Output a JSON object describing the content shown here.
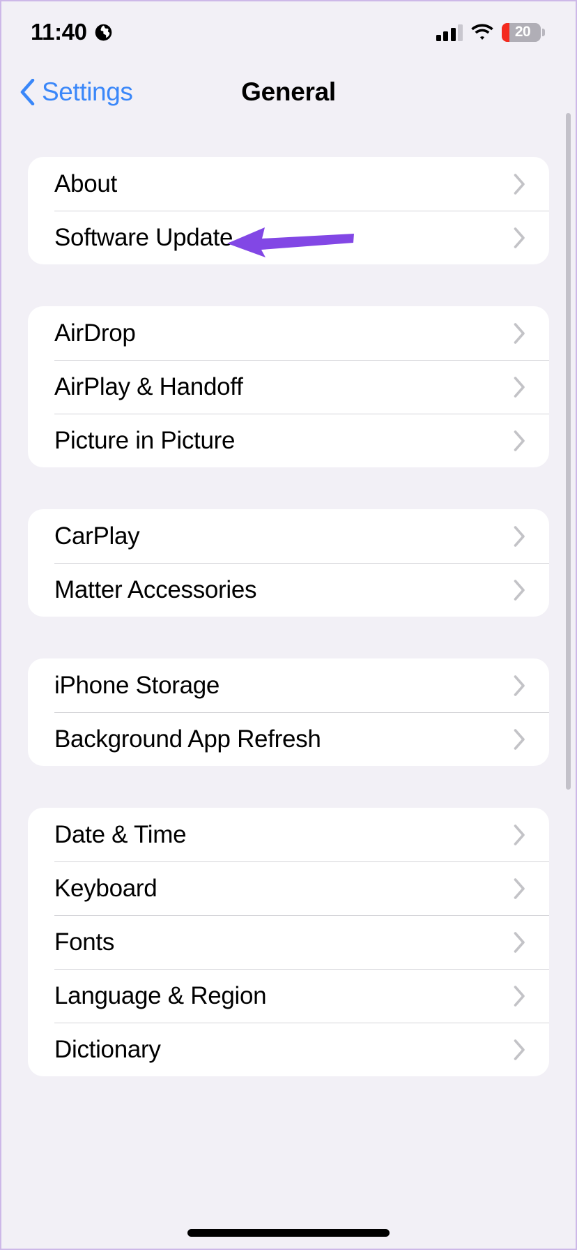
{
  "status_bar": {
    "time": "11:40",
    "location_icon": "globe-icon",
    "cellular_icon": "signal-bars-icon",
    "cellular_bars_filled": 3,
    "cellular_bars_total": 4,
    "wifi_icon": "wifi-icon",
    "battery_percent": "20",
    "battery_level": 20,
    "battery_color": "#F42A1E",
    "battery_icon": "battery-icon"
  },
  "nav": {
    "back_label": "Settings",
    "back_icon": "chevron-left-icon",
    "title": "General",
    "accent_color": "#3A87F9"
  },
  "annotation": {
    "type": "arrow",
    "direction": "left",
    "color": "#8247E5",
    "points_to": "Software Update"
  },
  "groups": [
    {
      "id": "group-system",
      "rows": [
        {
          "label": "About",
          "chevron": "chevron-right-icon"
        },
        {
          "label": "Software Update",
          "chevron": "chevron-right-icon"
        }
      ]
    },
    {
      "id": "group-sharing",
      "rows": [
        {
          "label": "AirDrop",
          "chevron": "chevron-right-icon"
        },
        {
          "label": "AirPlay & Handoff",
          "chevron": "chevron-right-icon"
        },
        {
          "label": "Picture in Picture",
          "chevron": "chevron-right-icon"
        }
      ]
    },
    {
      "id": "group-accessories",
      "rows": [
        {
          "label": "CarPlay",
          "chevron": "chevron-right-icon"
        },
        {
          "label": "Matter Accessories",
          "chevron": "chevron-right-icon"
        }
      ]
    },
    {
      "id": "group-storage",
      "rows": [
        {
          "label": "iPhone Storage",
          "chevron": "chevron-right-icon"
        },
        {
          "label": "Background App Refresh",
          "chevron": "chevron-right-icon"
        }
      ]
    },
    {
      "id": "group-localization",
      "rows": [
        {
          "label": "Date & Time",
          "chevron": "chevron-right-icon"
        },
        {
          "label": "Keyboard",
          "chevron": "chevron-right-icon"
        },
        {
          "label": "Fonts",
          "chevron": "chevron-right-icon"
        },
        {
          "label": "Language & Region",
          "chevron": "chevron-right-icon"
        },
        {
          "label": "Dictionary",
          "chevron": "chevron-right-icon"
        }
      ]
    }
  ],
  "theme": {
    "background": "#F2F0F6",
    "card": "#FFFFFF",
    "separator": "#D4D4D8",
    "chevron": "#C3C3C7",
    "text": "#000000"
  }
}
